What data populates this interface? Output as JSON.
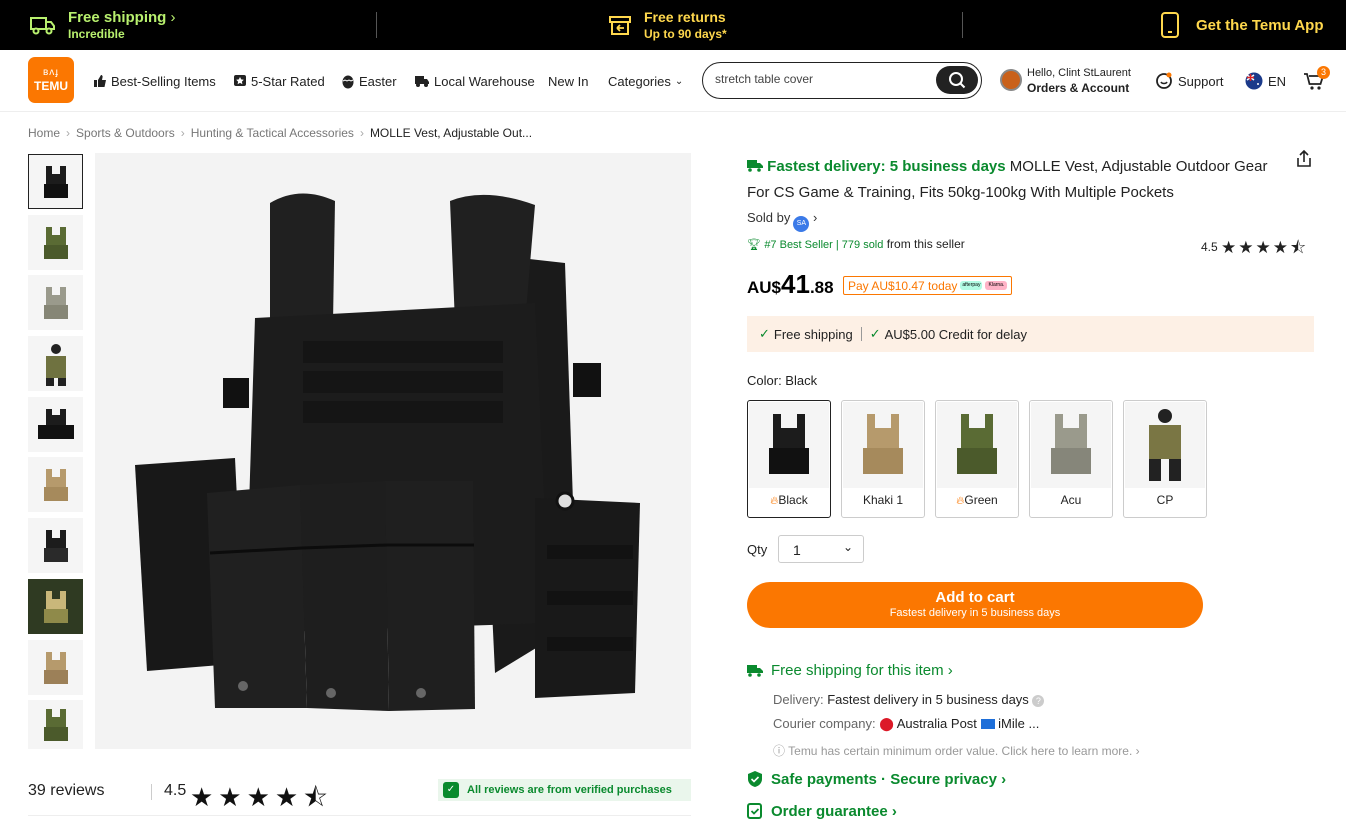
{
  "promo": {
    "shipping_title": "Free shipping",
    "shipping_sub": "Incredible",
    "returns_title": "Free returns",
    "returns_sub": "Up to 90 days*",
    "app_label": "Get the Temu App"
  },
  "header": {
    "logo_line1": "ʙᴧɟ",
    "logo_line2": "TEMU",
    "nav": [
      "Best-Selling Items",
      "5-Star Rated",
      "Easter",
      "Local Warehouse",
      "New In",
      "Categories"
    ],
    "search_value": "stretch table cover",
    "greeting": "Hello, Clint StLaurent",
    "account_label": "Orders & Account",
    "support_label": "Support",
    "lang": "EN",
    "cart_count": "3"
  },
  "breadcrumb": [
    "Home",
    "Sports & Outdoors",
    "Hunting & Tactical Accessories",
    "MOLLE Vest, Adjustable Out..."
  ],
  "reviews": {
    "count_label": "39 reviews",
    "score": "4.5",
    "stars": "★★★★⯪",
    "verified": "All reviews are from verified purchases"
  },
  "product": {
    "fast_delivery": "Fastest delivery: 5 business days",
    "title": "MOLLE Vest, Adjustable Outdoor Gear For CS Game & Training, Fits 50kg-100kg With Multiple Pockets",
    "sold_by": "Sold by",
    "seller_badge": "SA",
    "best_seller": "#7 Best Seller",
    "sold_count": "779 sold",
    "from_seller": "from this seller",
    "rating": "4.5",
    "rating_stars": "★★★★⯪",
    "price_currency": "AU$",
    "price_whole": "41",
    "price_decimal": ".88",
    "pay_today": "Pay AU$10.47 today",
    "afterpay": "afterpay",
    "klarna": "Klarna.",
    "free_shipping": "Free shipping",
    "credit_delay": "AU$5.00 Credit for delay",
    "color_label": "Color: Black",
    "colors": [
      {
        "name": "Black",
        "hot": true
      },
      {
        "name": "Khaki 1",
        "hot": false
      },
      {
        "name": "Green",
        "hot": true
      },
      {
        "name": "Acu",
        "hot": false
      },
      {
        "name": "CP",
        "hot": false
      }
    ],
    "qty_label": "Qty",
    "qty_value": "1",
    "cart_label": "Add to cart",
    "cart_sub": "Fastest delivery in 5 business days",
    "free_shipping_item": "Free shipping for this item",
    "delivery_label": "Delivery:",
    "delivery_value": "Fastest delivery in 5 business days",
    "courier_label": "Courier company:",
    "courier_1": "Australia Post",
    "courier_2": "iMile ...",
    "min_order": "Temu has certain minimum order value. Click here to learn more.",
    "safe_payments": "Safe payments · Secure privacy",
    "order_guarantee": "Order guarantee"
  },
  "colors": {
    "accent": "#fb7701",
    "green": "#0a8a2e",
    "promo_green": "#b8f06e",
    "promo_yellow": "#ffd84d"
  }
}
